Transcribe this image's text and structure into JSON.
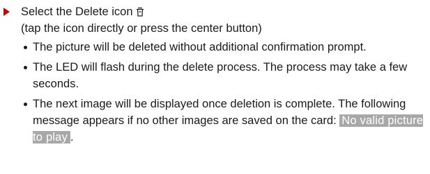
{
  "step": {
    "text_before_icon": "Select the Delete icon",
    "icon_name": "trash-icon",
    "note": "(tap the icon directly or press the center button)",
    "marker_color": "#cc0000"
  },
  "bullets": [
    {
      "text": "The picture will be deleted without additional confirmation prompt."
    },
    {
      "text": "The LED will flash during the delete process. The process may take a few seconds."
    },
    {
      "text": "The next image will be displayed once deletion is complete. The following message appears if no other images are saved on the card: ",
      "message": "No valid picture to play",
      "suffix": "."
    }
  ]
}
